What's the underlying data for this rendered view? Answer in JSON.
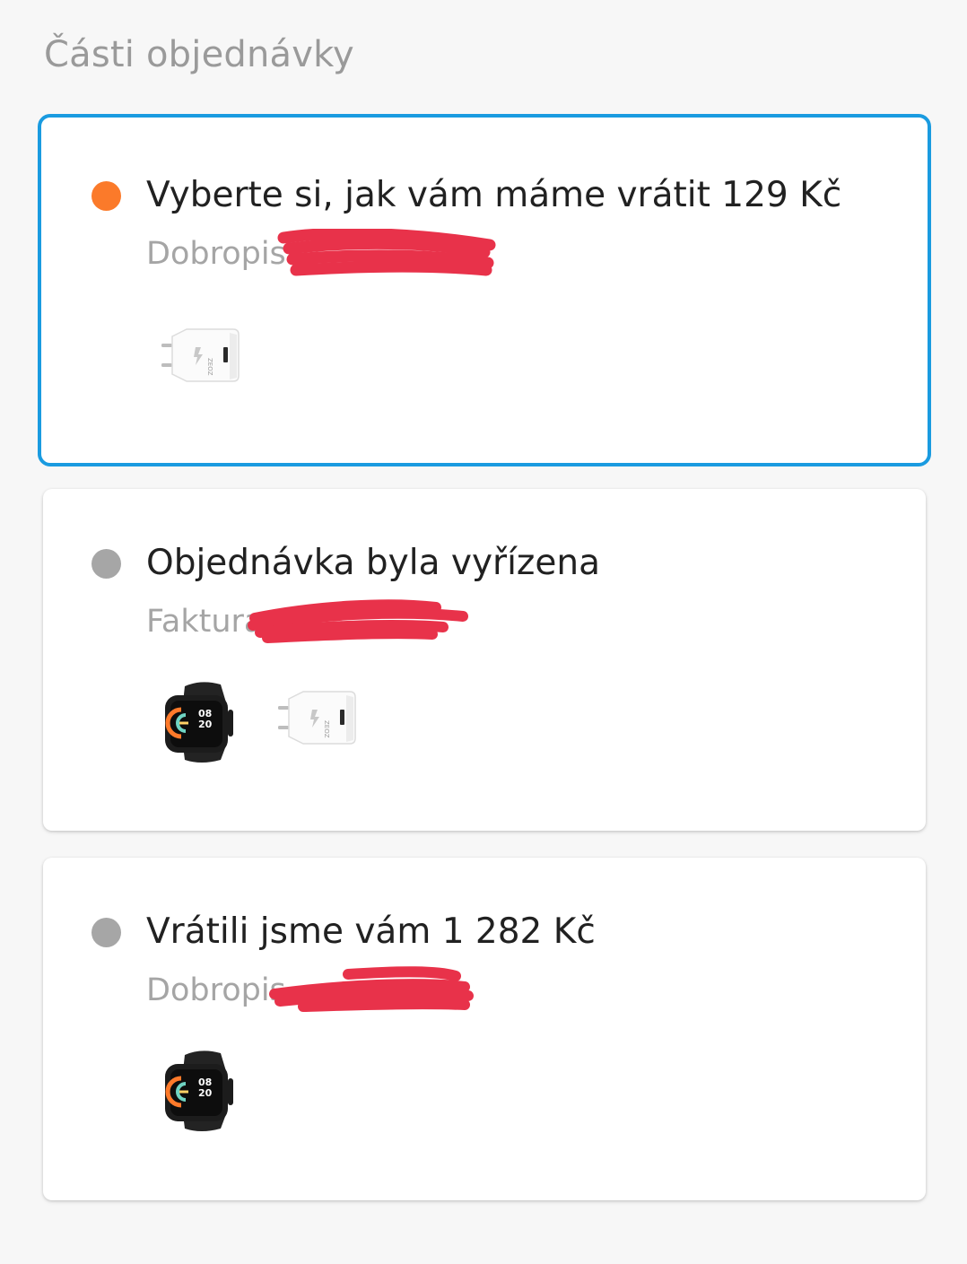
{
  "section": {
    "title": "Části objednávky"
  },
  "colors": {
    "selected_border": "#1a9be0",
    "status_active": "#fb7a2a",
    "status_inactive": "#a6a6a6",
    "redaction": "#e8324a"
  },
  "cards": [
    {
      "title": "Vyberte si, jak vám máme vrátit 129 Kč",
      "subtitle": "Dobropis",
      "status": "active",
      "selected": true,
      "products": [
        "charger-icon"
      ]
    },
    {
      "title": "Objednávka byla vyřízena",
      "subtitle": "Faktura",
      "status": "inactive",
      "selected": false,
      "products": [
        "smartwatch-icon",
        "charger-icon"
      ]
    },
    {
      "title": "Vrátili jsme vám 1 282 Kč",
      "subtitle": "Dobropis",
      "status": "inactive",
      "selected": false,
      "products": [
        "smartwatch-icon"
      ]
    }
  ]
}
